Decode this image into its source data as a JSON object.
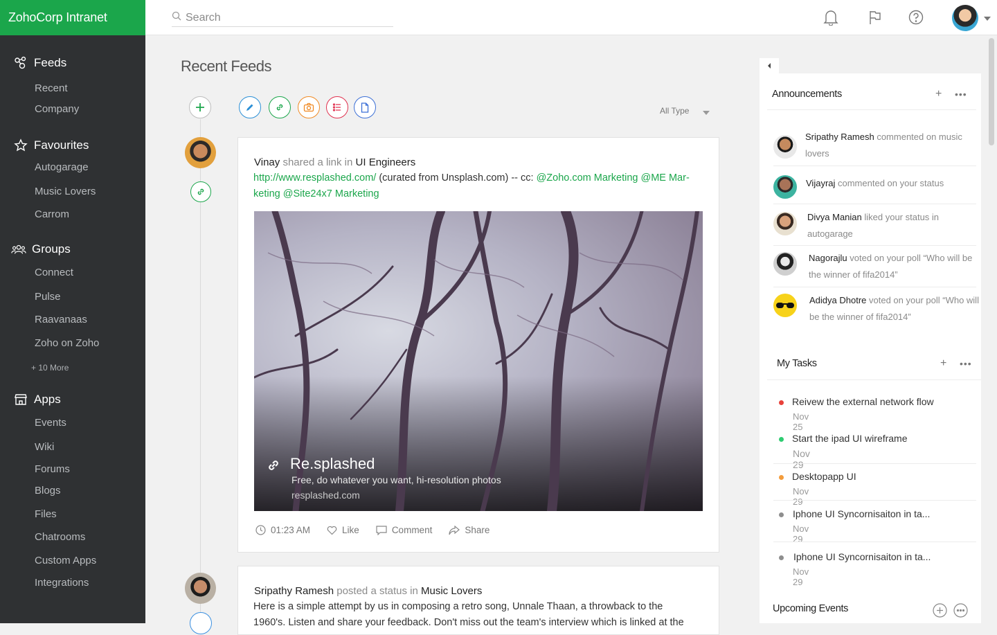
{
  "app": {
    "brand": "ZohoCorp Intranet"
  },
  "search": {
    "placeholder": "Search"
  },
  "sidebar": {
    "feeds": {
      "label": "Feeds",
      "items": [
        "Recent",
        "Company"
      ]
    },
    "favourites": {
      "label": "Favourites",
      "items": [
        "Autogarage",
        "Music Lovers",
        "Carrom"
      ]
    },
    "groups": {
      "label": "Groups",
      "items": [
        "Connect",
        "Pulse",
        "Raavanaas",
        "Zoho on Zoho"
      ],
      "more": "+ 10 More"
    },
    "apps": {
      "label": "Apps",
      "items": [
        "Events",
        "Wiki",
        "Forums",
        "Blogs",
        "Files",
        "Chatrooms",
        "Custom Apps",
        "Integrations"
      ]
    }
  },
  "main": {
    "title": "Recent Feeds",
    "filter": "All Type",
    "type_buttons": [
      {
        "icon": "pencil-icon",
        "color": "#2a8fd6"
      },
      {
        "icon": "link-icon",
        "color": "#1ba64b"
      },
      {
        "icon": "camera-icon",
        "color": "#f08a24"
      },
      {
        "icon": "list-icon",
        "color": "#e0304e"
      },
      {
        "icon": "document-icon",
        "color": "#3b6fd6"
      }
    ],
    "posts": [
      {
        "actor": "Vinay",
        "verb": "shared a link",
        "prep": "in",
        "group": "UI Engineers",
        "link": "http://www.resplashed.com/",
        "text": " (curated from Unsplash.com) --  cc: ",
        "mentions_line1": "@Zoho.com Marketing @ME Mar-",
        "mentions_line2": "keting @Site24x7 Marketing",
        "preview": {
          "title": "Re.splashed",
          "desc": "Free, do whatever you want, hi-resolution photos",
          "url": "resplashed.com"
        },
        "time": "01:23 AM",
        "like": "Like",
        "comment": "Comment",
        "share": "Share"
      },
      {
        "actor": "Sripathy Ramesh",
        "verb": "posted a status",
        "prep": "in",
        "group": "Music Lovers",
        "text_line1": "Here is a simple attempt by us in composing a retro song, Unnale Thaan, a throwback to the",
        "text_line2": "1960's. Listen and share your feedback. Don't miss out the team's interview which is linked at the"
      }
    ]
  },
  "announcements": {
    "title": "Announcements",
    "items": [
      {
        "name": "Sripathy Ramesh",
        "text": " commented on music lovers"
      },
      {
        "name": "Vijayraj",
        "text": " commented on your status"
      },
      {
        "name": "Divya Manian",
        "text": " liked your status in autogarage"
      },
      {
        "name": "Nagorajlu",
        "text": " voted on your poll “Who will be the winner of fifa2014”"
      },
      {
        "name": "Adidya Dhotre",
        "text": " voted on your poll “Who will be the winner of fifa2014”"
      }
    ]
  },
  "tasks": {
    "title": "My Tasks",
    "items": [
      {
        "title": "Reivew the external network flow",
        "date": "Nov 25",
        "color": "#e8413a"
      },
      {
        "title": "Start the ipad UI wireframe",
        "date": "Nov 29",
        "color": "#2ecc71"
      },
      {
        "title": "Desktopapp UI",
        "date": "Nov 29",
        "color": "#f39c3c"
      },
      {
        "title": "Iphone UI Syncornisaiton in ta...",
        "date": "Nov 29",
        "color": "#8e8e8e"
      },
      {
        "title": "Iphone UI Syncornisaiton in ta...",
        "date": "Nov 29",
        "color": "#8e8e8e"
      }
    ]
  },
  "events": {
    "title": "Upcoming Events"
  }
}
